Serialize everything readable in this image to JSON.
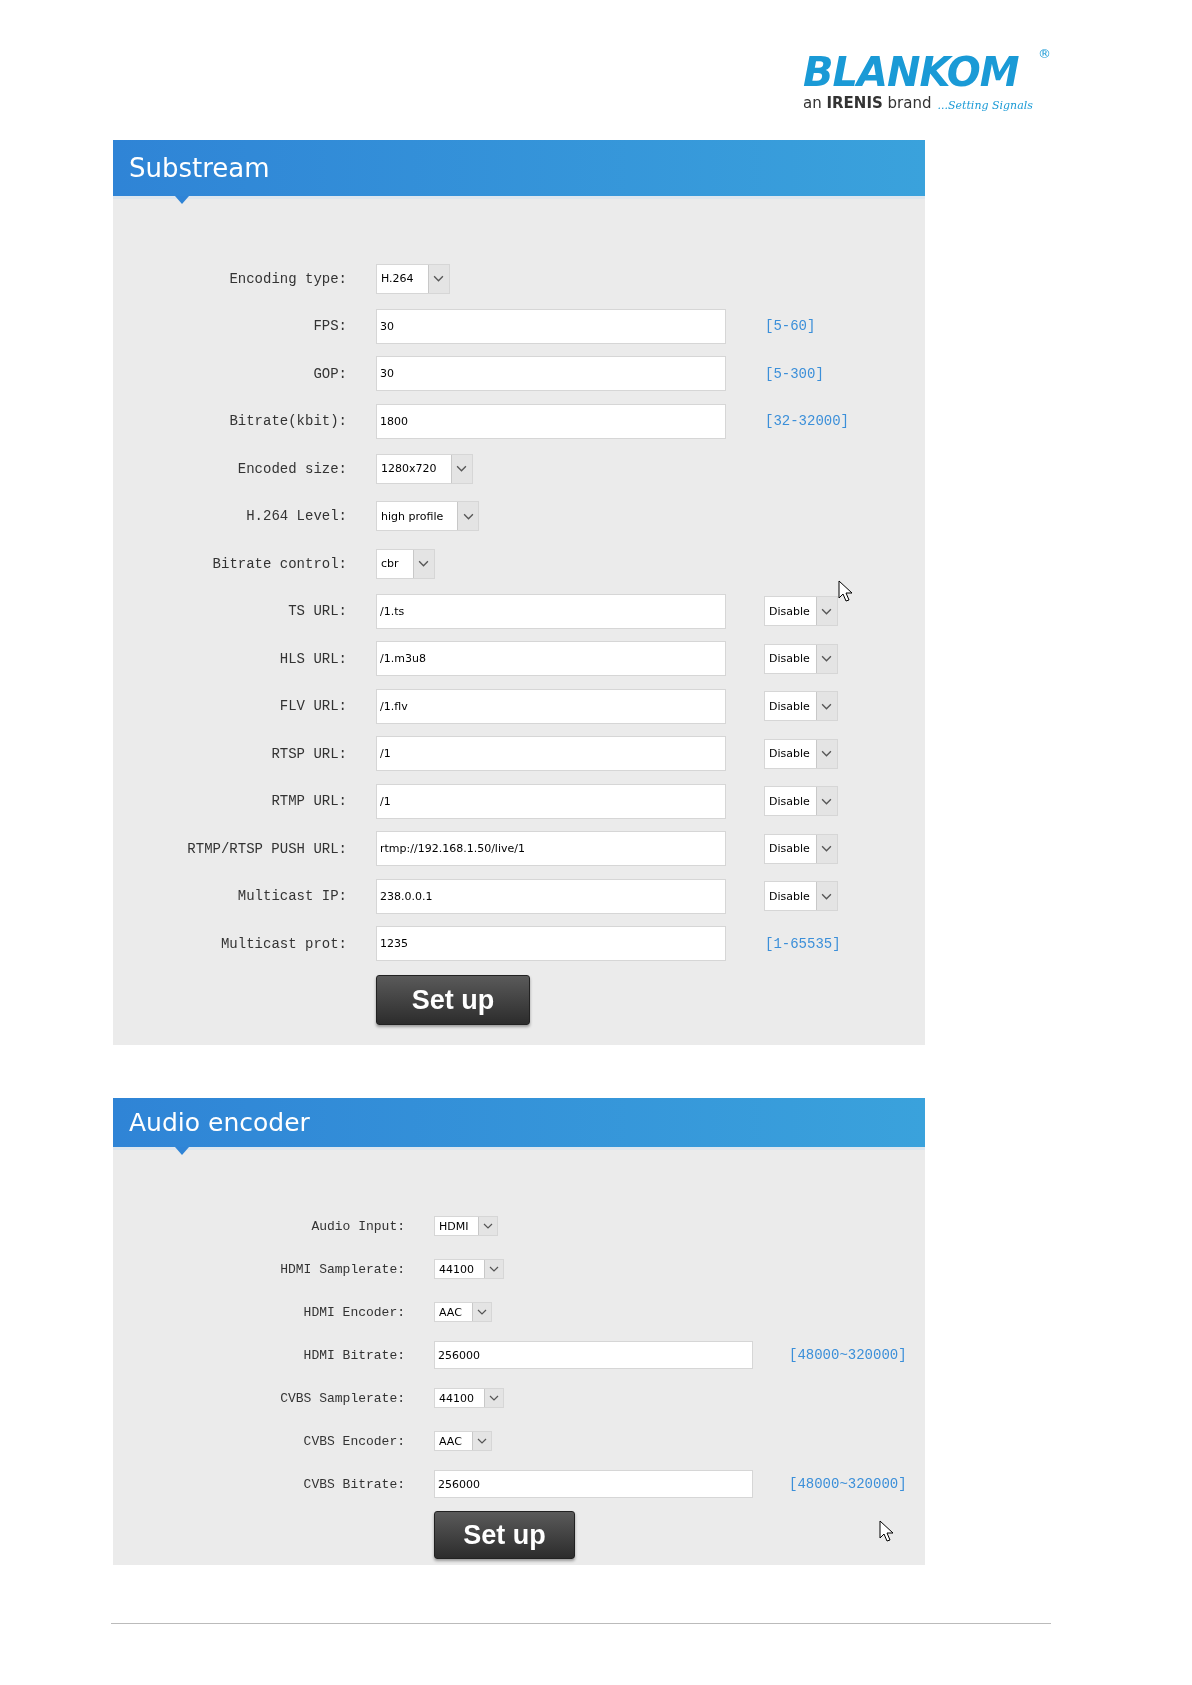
{
  "logo": {
    "brand": "BLANKOM",
    "registered": "®",
    "tagline": "an **IRENIS** brand",
    "slogan": "...Setting Signals"
  },
  "sections": [
    {
      "title": "Substream",
      "rows": [
        {
          "kind": "select",
          "label": "Encoding type:",
          "value": "H.264"
        },
        {
          "kind": "text",
          "label": "FPS:",
          "value": "30",
          "hint": "[5-60]"
        },
        {
          "kind": "text",
          "label": "GOP:",
          "value": "30",
          "hint": "[5-300]"
        },
        {
          "kind": "text",
          "label": "Bitrate(kbit):",
          "value": "1800",
          "hint": "[32-32000]"
        },
        {
          "kind": "select",
          "label": "Encoded size:",
          "value": "1280x720"
        },
        {
          "kind": "select",
          "label": "H.264 Level:",
          "value": "high profile"
        },
        {
          "kind": "select",
          "label": "Bitrate control:",
          "value": "cbr"
        },
        {
          "kind": "url",
          "label": "TS URL:",
          "value": "/1.ts",
          "option": "Disable"
        },
        {
          "kind": "url",
          "label": "HLS URL:",
          "value": "/1.m3u8",
          "option": "Disable"
        },
        {
          "kind": "url",
          "label": "FLV URL:",
          "value": "/1.flv",
          "option": "Disable"
        },
        {
          "kind": "url",
          "label": "RTSP URL:",
          "value": "/1",
          "option": "Disable"
        },
        {
          "kind": "url",
          "label": "RTMP URL:",
          "value": "/1",
          "option": "Disable"
        },
        {
          "kind": "url",
          "label": "RTMP/RTSP PUSH URL:",
          "value": "rtmp://192.168.1.50/live/1",
          "option": "Disable"
        },
        {
          "kind": "url",
          "label": "Multicast IP:",
          "value": "238.0.0.1",
          "option": "Disable"
        },
        {
          "kind": "text",
          "label": "Multicast prot:",
          "value": "1235",
          "hint": "[1-65535]"
        }
      ],
      "button": "Set up"
    },
    {
      "title": "Audio encoder",
      "rows": [
        {
          "kind": "select",
          "label": "Audio Input:",
          "value": "HDMI"
        },
        {
          "kind": "select",
          "label": "HDMI Samplerate:",
          "value": "44100"
        },
        {
          "kind": "select",
          "label": "HDMI Encoder:",
          "value": "AAC"
        },
        {
          "kind": "text",
          "label": "HDMI Bitrate:",
          "value": "256000",
          "hint": "[48000~320000]"
        },
        {
          "kind": "select",
          "label": "CVBS Samplerate:",
          "value": "44100"
        },
        {
          "kind": "select",
          "label": "CVBS Encoder:",
          "value": "AAC"
        },
        {
          "kind": "text",
          "label": "CVBS Bitrate:",
          "value": "256000",
          "hint": "[48000~320000]"
        }
      ],
      "button": "Set up"
    }
  ]
}
